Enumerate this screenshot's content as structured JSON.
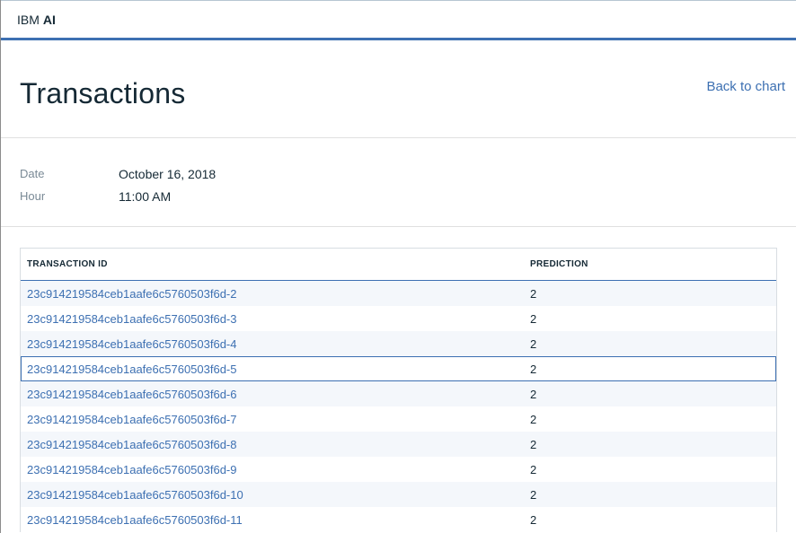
{
  "header": {
    "brand": "IBM",
    "brand_bold": "AI"
  },
  "page": {
    "title": "Transactions",
    "back_link": "Back to chart"
  },
  "meta": {
    "date_label": "Date",
    "date_value": "October 16, 2018",
    "hour_label": "Hour",
    "hour_value": "11:00 AM"
  },
  "table": {
    "columns": [
      "TRANSACTION ID",
      "PREDICTION"
    ],
    "rows": [
      {
        "id": "23c914219584ceb1aafe6c5760503f6d-2",
        "prediction": "2"
      },
      {
        "id": "23c914219584ceb1aafe6c5760503f6d-3",
        "prediction": "2"
      },
      {
        "id": "23c914219584ceb1aafe6c5760503f6d-4",
        "prediction": "2"
      },
      {
        "id": "23c914219584ceb1aafe6c5760503f6d-5",
        "prediction": "2"
      },
      {
        "id": "23c914219584ceb1aafe6c5760503f6d-6",
        "prediction": "2"
      },
      {
        "id": "23c914219584ceb1aafe6c5760503f6d-7",
        "prediction": "2"
      },
      {
        "id": "23c914219584ceb1aafe6c5760503f6d-8",
        "prediction": "2"
      },
      {
        "id": "23c914219584ceb1aafe6c5760503f6d-9",
        "prediction": "2"
      },
      {
        "id": "23c914219584ceb1aafe6c5760503f6d-10",
        "prediction": "2"
      },
      {
        "id": "23c914219584ceb1aafe6c5760503f6d-11",
        "prediction": "2"
      }
    ],
    "selected_row_index": 3
  },
  "colors": {
    "accent": "#3d70b2",
    "text": "#152935",
    "muted": "#7a8a96",
    "stripe": "#f4f7fb"
  }
}
